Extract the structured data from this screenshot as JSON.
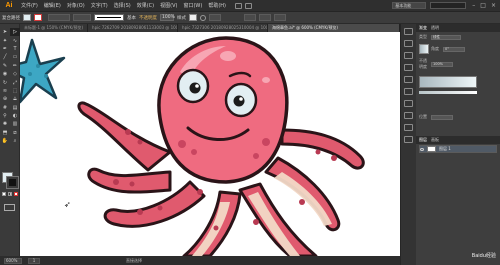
{
  "app": {
    "logo": "Ai"
  },
  "menubar": {
    "items": [
      "文件(F)",
      "编辑(E)",
      "对象(O)",
      "文字(T)",
      "选择(S)",
      "效果(C)",
      "视图(V)",
      "窗口(W)",
      "帮助(H)"
    ],
    "workspace": "基本功能"
  },
  "controlbar": {
    "mode_label": "复合路径",
    "fill_color": "#e2eef2",
    "stroke_color": "#d23a3a",
    "brush_label": "基本",
    "opacity_label": "不透明度",
    "opacity_value": "100%",
    "style_label": "样式"
  },
  "tabs": [
    {
      "label": "未标题-1 @ 150% (CMYK/预览)"
    },
    {
      "label": "hpic 7262709 20180928061133003 @ 100% (RGB/预览)"
    },
    {
      "label": "hpic 7327306 20180928025310004 @ 100% (RGB/预览)"
    },
    {
      "label": "海绵章鱼.ai* @ 600% (CMYK/预览)"
    }
  ],
  "statusbar": {
    "zoom": "600%",
    "artboard": "1",
    "tool": "直接选择"
  },
  "panels": {
    "tabs": [
      "渐变",
      "透明"
    ],
    "type_label": "类型",
    "type_value": "线性",
    "angle_label": "角度",
    "angle_value": "0°",
    "opacity_label": "不透明度",
    "opacity_value": "100%",
    "location_label": "位置",
    "layers_tabs": [
      "图层",
      "画板"
    ],
    "layer_name": "图层 1",
    "gradient_colors": [
      "#a9b8bf",
      "#eef6f8"
    ]
  },
  "watermark": "Baidu经验"
}
